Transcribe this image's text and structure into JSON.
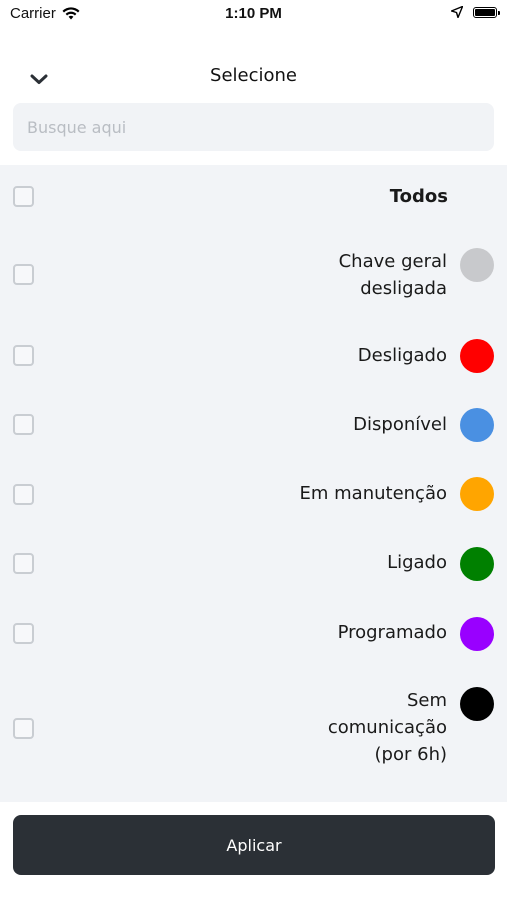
{
  "status_bar": {
    "carrier": "Carrier",
    "time": "1:10 PM"
  },
  "header": {
    "title": "Selecione"
  },
  "search": {
    "placeholder": "Busque aqui",
    "value": ""
  },
  "filter": {
    "all_label": "Todos",
    "items": [
      {
        "label_lines": [
          "Chave geral",
          "desligada"
        ],
        "color": "#c8c9cc",
        "checked": false
      },
      {
        "label_lines": [
          "Desligado"
        ],
        "color": "#ff0000",
        "checked": false
      },
      {
        "label_lines": [
          "Disponível"
        ],
        "color": "#4a90e2",
        "checked": false
      },
      {
        "label_lines": [
          "Em manutenção"
        ],
        "color": "#ffa500",
        "checked": false
      },
      {
        "label_lines": [
          "Ligado"
        ],
        "color": "#008000",
        "checked": false
      },
      {
        "label_lines": [
          "Programado"
        ],
        "color": "#9900ff",
        "checked": false
      },
      {
        "label_lines": [
          "Sem",
          "comunicação",
          "(por 6h)"
        ],
        "color": "#000000",
        "checked": false
      }
    ]
  },
  "footer": {
    "apply_label": "Aplicar"
  }
}
